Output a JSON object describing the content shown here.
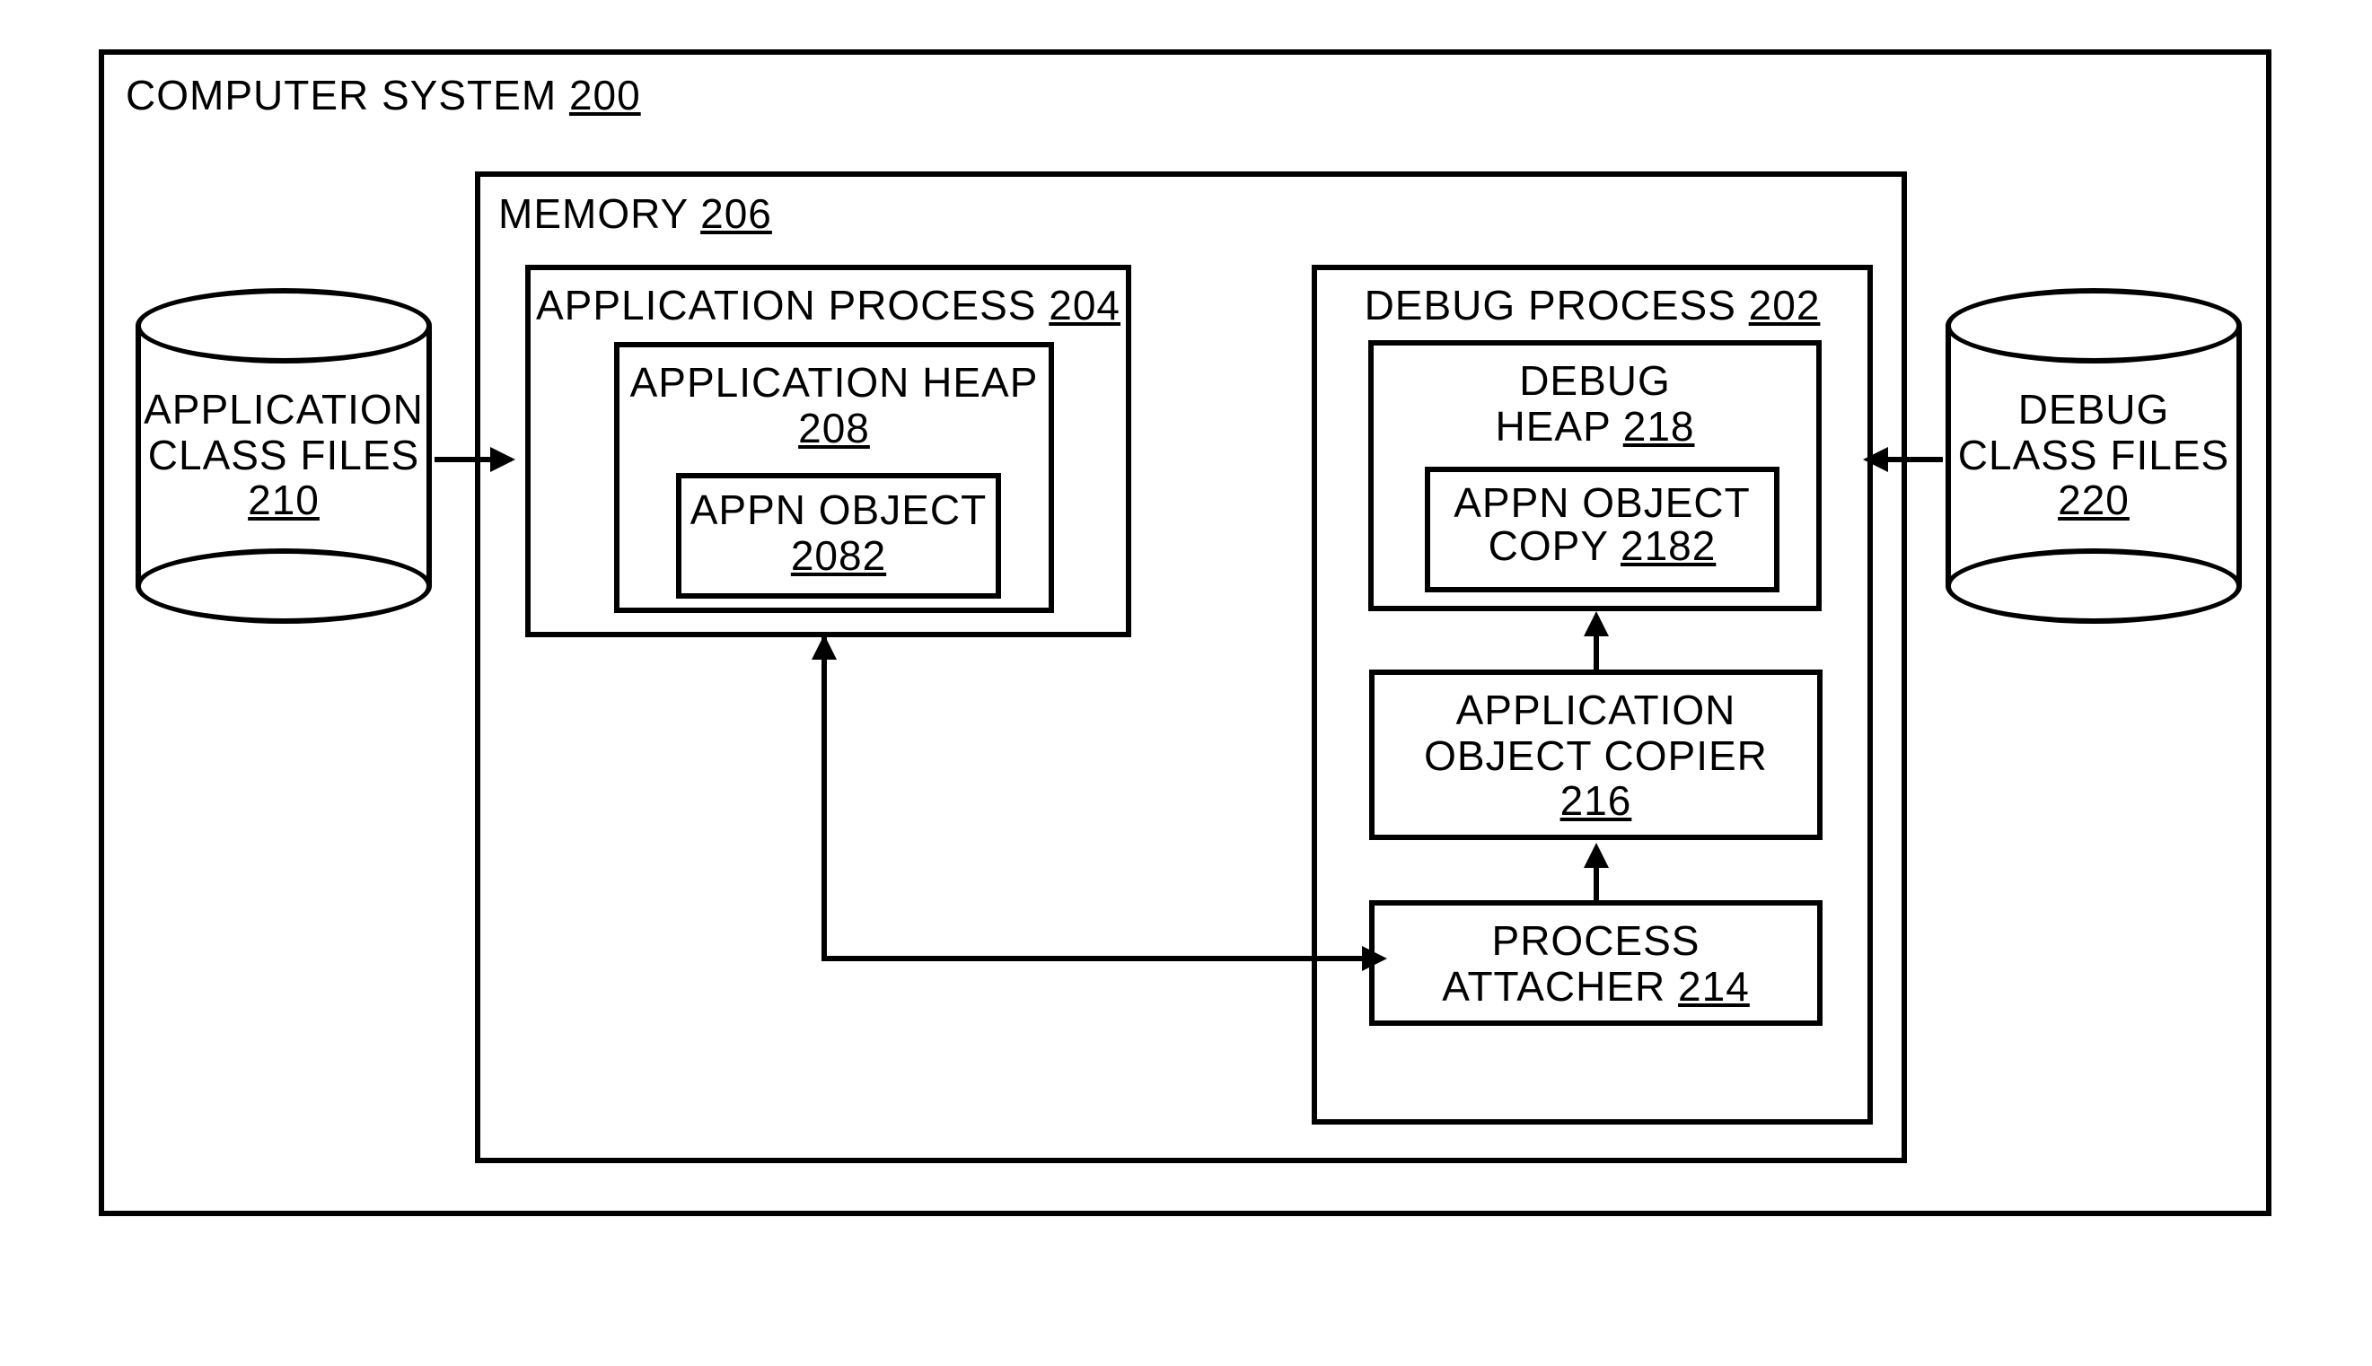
{
  "computerSystem": {
    "label": "COMPUTER SYSTEM",
    "ref": "200"
  },
  "memory": {
    "label": "MEMORY",
    "ref": "206"
  },
  "appProcess": {
    "label": "APPLICATION PROCESS",
    "ref": "204"
  },
  "appHeap": {
    "label": "APPLICATION HEAP",
    "ref": "208"
  },
  "appnObject": {
    "label": "APPN OBJECT",
    "ref": "2082"
  },
  "debugProcess": {
    "label": "DEBUG PROCESS",
    "ref": "202"
  },
  "debugHeap": {
    "labelLine1": "DEBUG",
    "labelLine2": "HEAP",
    "ref": "218"
  },
  "appnObjectCopy": {
    "labelLine1": "APPN OBJECT",
    "labelLine2": "COPY",
    "ref": "2182"
  },
  "appObjectCopier": {
    "labelLine1": "APPLICATION",
    "labelLine2": "OBJECT COPIER",
    "ref": "216"
  },
  "processAttacher": {
    "labelLine1": "PROCESS",
    "labelLine2": "ATTACHER",
    "ref": "214"
  },
  "appClassFiles": {
    "labelLine1": "APPLICATION",
    "labelLine2": "CLASS FILES",
    "ref": "210"
  },
  "debugClassFiles": {
    "labelLine1": "DEBUG",
    "labelLine2": "CLASS FILES",
    "ref": "220"
  }
}
